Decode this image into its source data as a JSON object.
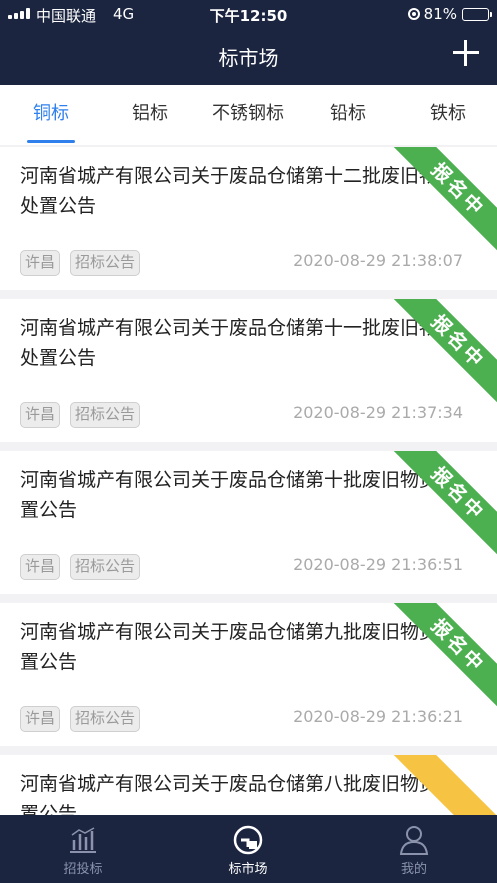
{
  "status": {
    "carrier": "中国联通",
    "network": "4G",
    "time": "下午12:50",
    "battery": "81%",
    "battery_level": 0.81
  },
  "header": {
    "title": "标市场",
    "add_icon": "plus-icon"
  },
  "tabs": [
    {
      "label": "铜标",
      "active": true
    },
    {
      "label": "铝标",
      "active": false
    },
    {
      "label": "不锈钢标",
      "active": false
    },
    {
      "label": "铅标",
      "active": false
    },
    {
      "label": "铁标",
      "active": false
    }
  ],
  "items": [
    {
      "title": "河南省城产有限公司关于废品仓储第十二批废旧物资处置公告",
      "city": "许昌",
      "type": "招标公告",
      "date": "2020-08-29 21:38:07",
      "status": "报名中",
      "status_color": "#4caf50"
    },
    {
      "title": "河南省城产有限公司关于废品仓储第十一批废旧物资处置公告",
      "city": "许昌",
      "type": "招标公告",
      "date": "2020-08-29 21:37:34",
      "status": "报名中",
      "status_color": "#4caf50"
    },
    {
      "title": "河南省城产有限公司关于废品仓储第十批废旧物资处置公告",
      "city": "许昌",
      "type": "招标公告",
      "date": "2020-08-29 21:36:51",
      "status": "报名中",
      "status_color": "#4caf50"
    },
    {
      "title": "河南省城产有限公司关于废品仓储第九批废旧物资处置公告",
      "city": "许昌",
      "type": "招标公告",
      "date": "2020-08-29 21:36:21",
      "status": "报名中",
      "status_color": "#4caf50"
    },
    {
      "title": "河南省城产有限公司关于废品仓储第八批废旧物资处置公告",
      "city": "",
      "type": "",
      "date": "",
      "status": "",
      "status_color": "#f6c343"
    }
  ],
  "bottom_nav": [
    {
      "label": "招投标",
      "icon": "chart-icon",
      "active": false
    },
    {
      "label": "标市场",
      "icon": "market-icon",
      "active": true
    },
    {
      "label": "我的",
      "icon": "user-icon",
      "active": false
    }
  ],
  "colors": {
    "header_bg": "#1c2540",
    "accent": "#2f80ed",
    "ribbon_green": "#4caf50",
    "ribbon_yellow": "#f6c343"
  }
}
